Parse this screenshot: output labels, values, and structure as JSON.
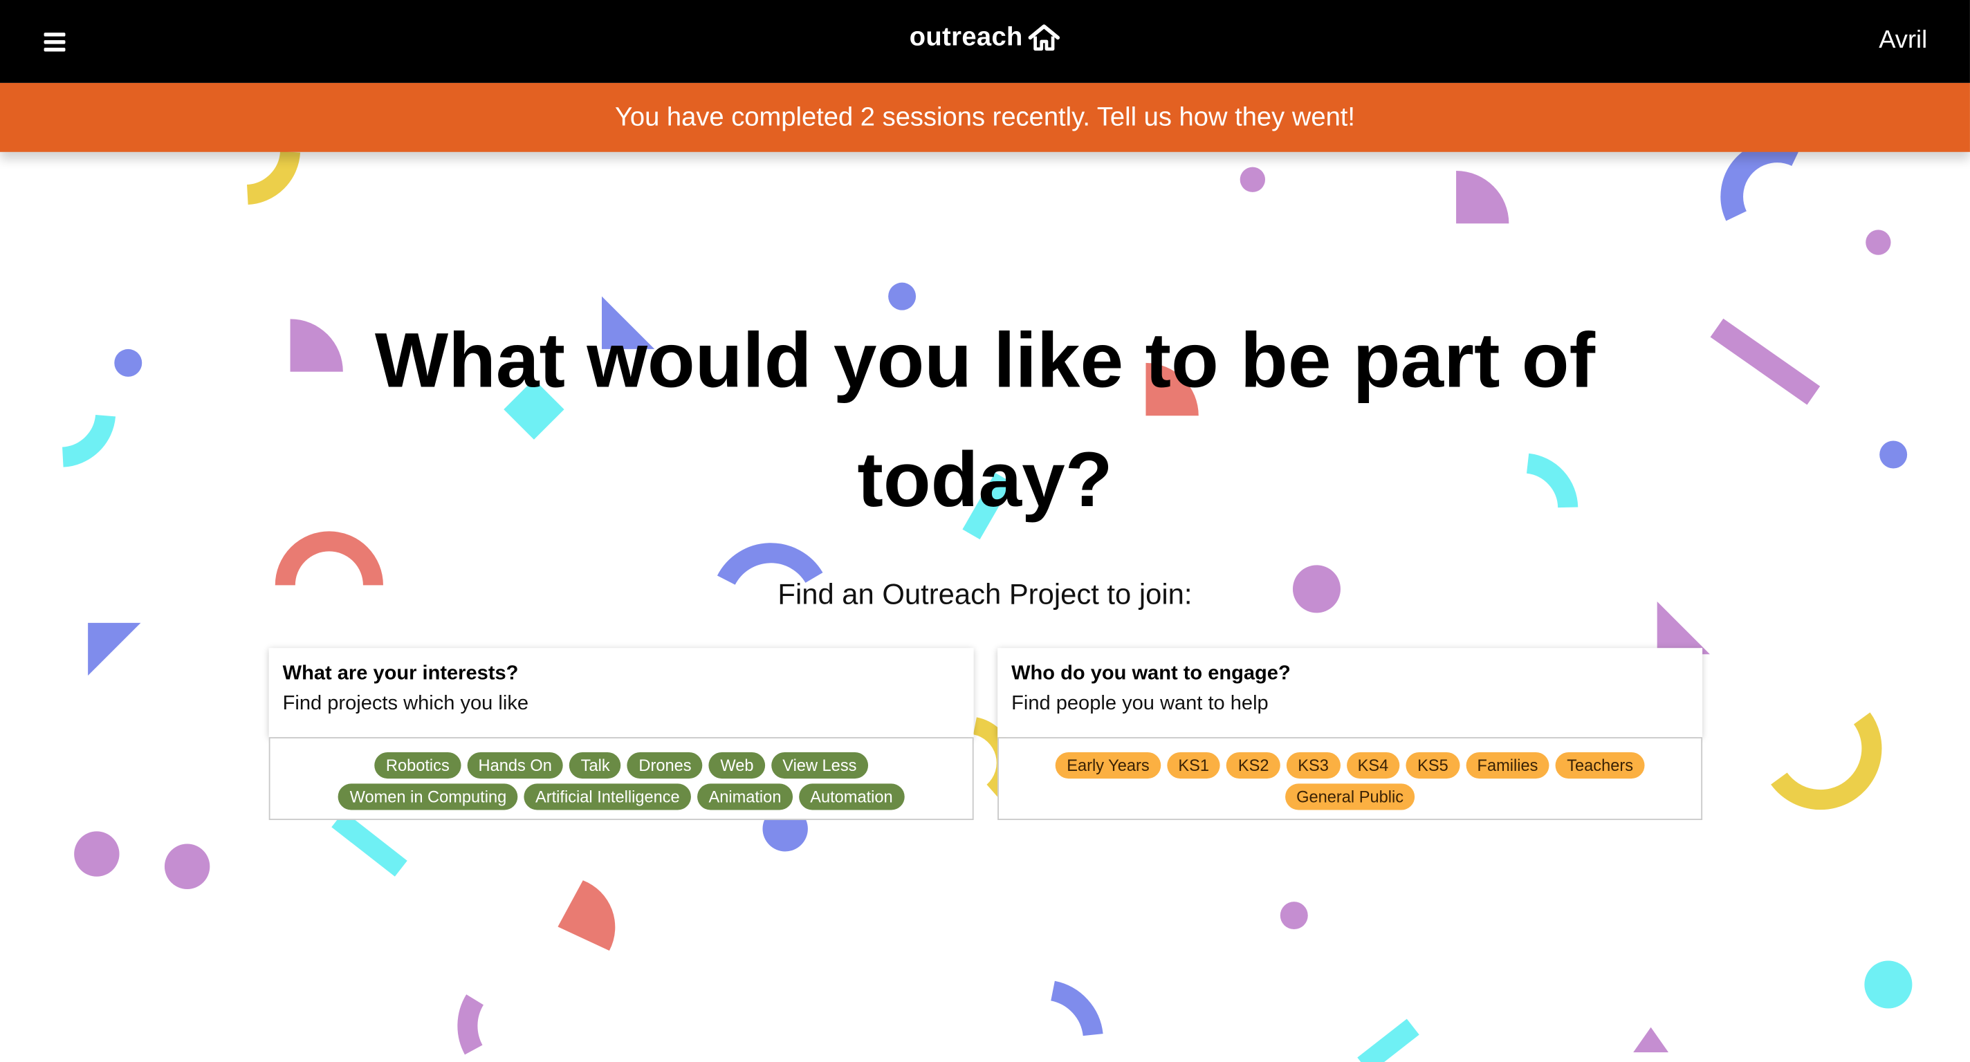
{
  "nav": {
    "menu_icon": "hamburger-menu-icon",
    "brand": "outreach",
    "brand_icon": "house-icon",
    "user": "Avril"
  },
  "banner": {
    "text": "You have completed 2 sessions recently. Tell us how they went!"
  },
  "main": {
    "headline_line1": "What would you like to be part of",
    "headline_line2": "today?",
    "subheading": "Find an Outreach Project to join:"
  },
  "interests": {
    "title": "What are your interests?",
    "subtitle": "Find projects which you like",
    "tags_row1": [
      "Robotics",
      "Hands On",
      "Talk",
      "Drones",
      "Web",
      "View Less"
    ],
    "tags_row2": [
      "Women in Computing",
      "Artificial Intelligence",
      "Animation",
      "Automation"
    ]
  },
  "audience": {
    "title": "Who do you want to engage?",
    "subtitle": "Find people you want to help",
    "tags_row1": [
      "Early Years",
      "KS1",
      "KS2",
      "KS3",
      "KS4",
      "KS5",
      "Families",
      "Teachers"
    ],
    "tags_row2": [
      "General Public"
    ]
  },
  "colors": {
    "topbar": "#000000",
    "banner": "#e36122",
    "interest_tag": "#6a8b45",
    "audience_tag": "#fbb042",
    "confetti": [
      "#c58ed1",
      "#7f8cec",
      "#6ff0f4",
      "#e97b72",
      "#eccf4a"
    ]
  }
}
